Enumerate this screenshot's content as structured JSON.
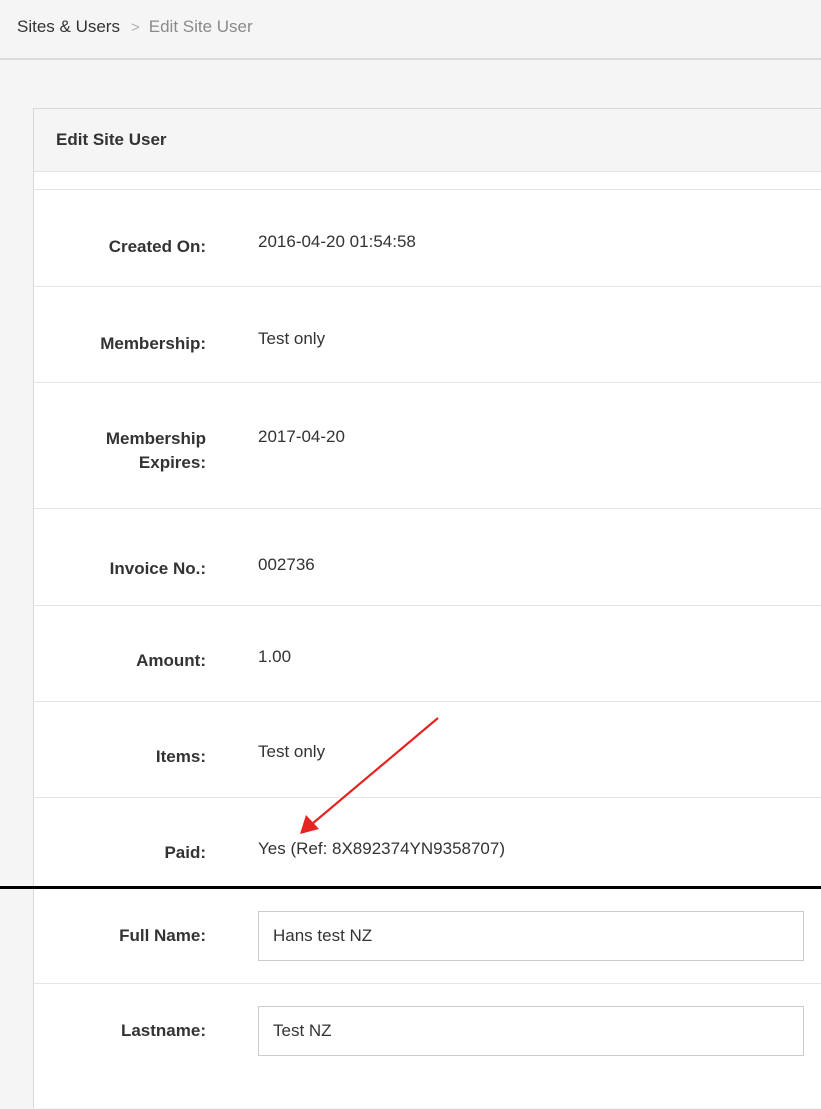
{
  "breadcrumb": {
    "parent": "Sites & Users",
    "separator": ">",
    "current": "Edit Site User"
  },
  "panel": {
    "title": "Edit Site User"
  },
  "details": [
    {
      "label": "Created On:",
      "value": "2016-04-20 01:54:58"
    },
    {
      "label": "Membership:",
      "value": "Test only"
    },
    {
      "label": "Membership Expires:",
      "value": "2017-04-20"
    },
    {
      "label": "Invoice No.:",
      "value": "002736"
    },
    {
      "label": "Amount:",
      "value": "1.00"
    },
    {
      "label": "Items:",
      "value": "Test only"
    },
    {
      "label": "Paid:",
      "value": "Yes (Ref: 8X892374YN9358707)"
    }
  ],
  "form": {
    "full_name": {
      "label": "Full Name:",
      "value": "Hans test NZ"
    },
    "lastname": {
      "label": "Lastname:",
      "value": "Test NZ"
    }
  },
  "annotation": {
    "arrow_color": "#e52421"
  }
}
